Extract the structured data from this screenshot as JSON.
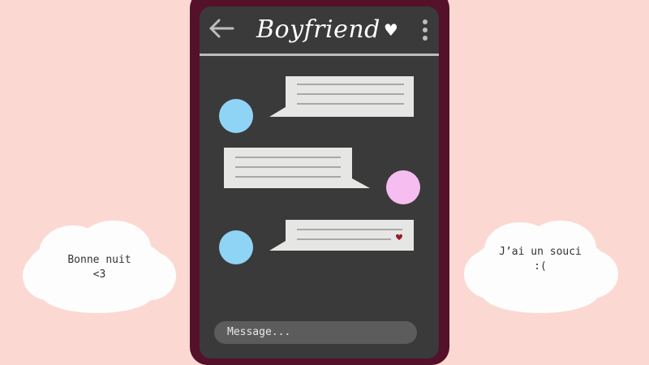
{
  "header": {
    "title": "Boyfriend",
    "title_heart": "♥",
    "back_icon": "arrow-left-icon",
    "menu_icon": "kebab-menu-icon"
  },
  "messages": [
    {
      "from": "contact",
      "lines": 3,
      "has_heart": false,
      "avatar_color": "#8fd4f5"
    },
    {
      "from": "self",
      "lines": 3,
      "has_heart": false,
      "avatar_color": "#f5bdf0"
    },
    {
      "from": "contact",
      "lines": 2,
      "has_heart": true,
      "avatar_color": "#8fd4f5"
    }
  ],
  "input": {
    "placeholder": "Message..."
  },
  "clouds": {
    "left_text": "Bonne nuit\n<3",
    "right_text": "J’ai un souci\n:("
  },
  "colors": {
    "background": "#fbd9d2",
    "phone_frame": "#55102a",
    "screen": "#3a3a3a",
    "bubble": "#e6e6e4",
    "bubble_line": "#a8a8a8",
    "heart": "#9b1b22"
  }
}
